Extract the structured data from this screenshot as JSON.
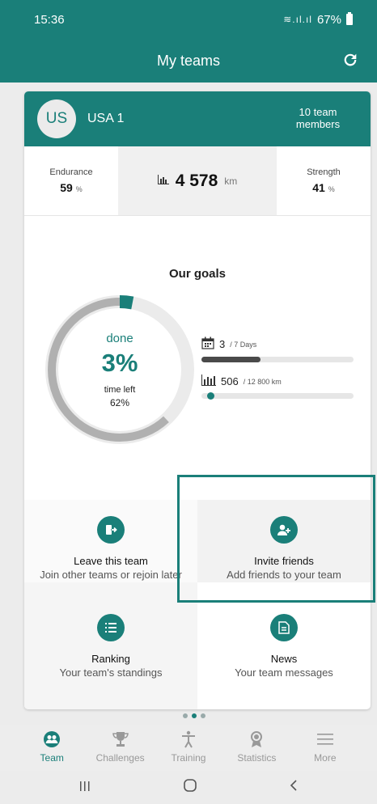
{
  "status_bar": {
    "time": "15:36",
    "signal": "≋.ıl.ıl",
    "battery": "67%"
  },
  "app_bar": {
    "title": "My teams"
  },
  "team": {
    "initials": "US",
    "name": "USA 1",
    "members": "10 team members"
  },
  "stats": {
    "endurance_label": "Endurance",
    "endurance_value": "59",
    "endurance_unit": "%",
    "distance_value": "4 578",
    "distance_unit": "km",
    "strength_label": "Strength",
    "strength_value": "41",
    "strength_unit": "%"
  },
  "goals": {
    "title": "Our goals",
    "done_label": "done",
    "done_value": "3%",
    "done_fraction": 0.03,
    "time_left_label": "time left",
    "time_left_value": "62%",
    "time_left_fraction": 0.62,
    "days_value": "3",
    "days_total": "/ 7 Days",
    "days_fraction": 0.3857,
    "km_value": "506",
    "km_total": "/ 12 800 km",
    "km_fraction": 0.0395
  },
  "actions": [
    {
      "label": "Leave this team",
      "sub": "Join other teams or rejoin later",
      "icon": "exit-icon"
    },
    {
      "label": "Invite friends",
      "sub": "Add friends to your team",
      "icon": "add-user-icon"
    },
    {
      "label": "Ranking",
      "sub": "Your team's standings",
      "icon": "list-icon"
    },
    {
      "label": "News",
      "sub": "Your team messages",
      "icon": "document-icon"
    }
  ],
  "nav": [
    {
      "label": "Team",
      "icon": "team-icon",
      "active": true
    },
    {
      "label": "Challenges",
      "icon": "trophy-icon",
      "active": false
    },
    {
      "label": "Training",
      "icon": "person-icon",
      "active": false
    },
    {
      "label": "Statistics",
      "icon": "medal-icon",
      "active": false
    },
    {
      "label": "More",
      "icon": "menu-icon",
      "active": false
    }
  ],
  "colors": {
    "accent": "#1a7f79",
    "inactive": "#999999"
  }
}
